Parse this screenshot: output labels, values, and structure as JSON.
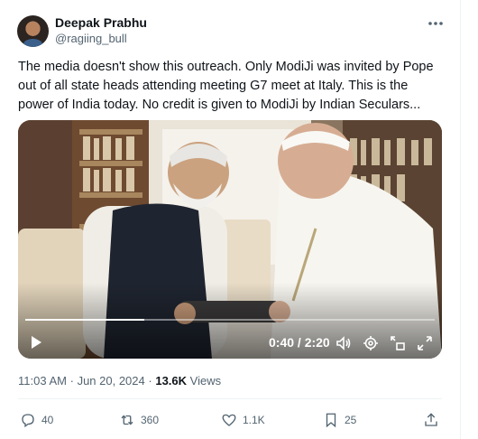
{
  "author": {
    "name": "Deepak Prabhu",
    "handle": "@ragiing_bull"
  },
  "tweet": {
    "text": "The media doesn't show this outreach. Only ModiJi was invited by Pope out of all state heads attending meeting G7 meet at Italy. This is the power of India today. No credit is given to ModiJi by Indian Seculars..."
  },
  "video": {
    "time": "0:40 / 2:20",
    "progress": 0.29
  },
  "meta": {
    "time": "11:03 AM",
    "date": "Jun 20, 2024",
    "views_count": "13.6K",
    "views_label": "Views",
    "separator": "·"
  },
  "actions": {
    "replies": "40",
    "reposts": "360",
    "likes": "1.1K",
    "bookmarks": "25"
  },
  "icons": [
    "more-icon",
    "play-icon",
    "volume-icon",
    "settings-icon",
    "minimize-icon",
    "fullscreen-icon",
    "reply-icon",
    "repost-icon",
    "like-icon",
    "bookmark-icon",
    "share-icon"
  ],
  "colors": {
    "text": "#0f1419",
    "secondary": "#536471"
  }
}
